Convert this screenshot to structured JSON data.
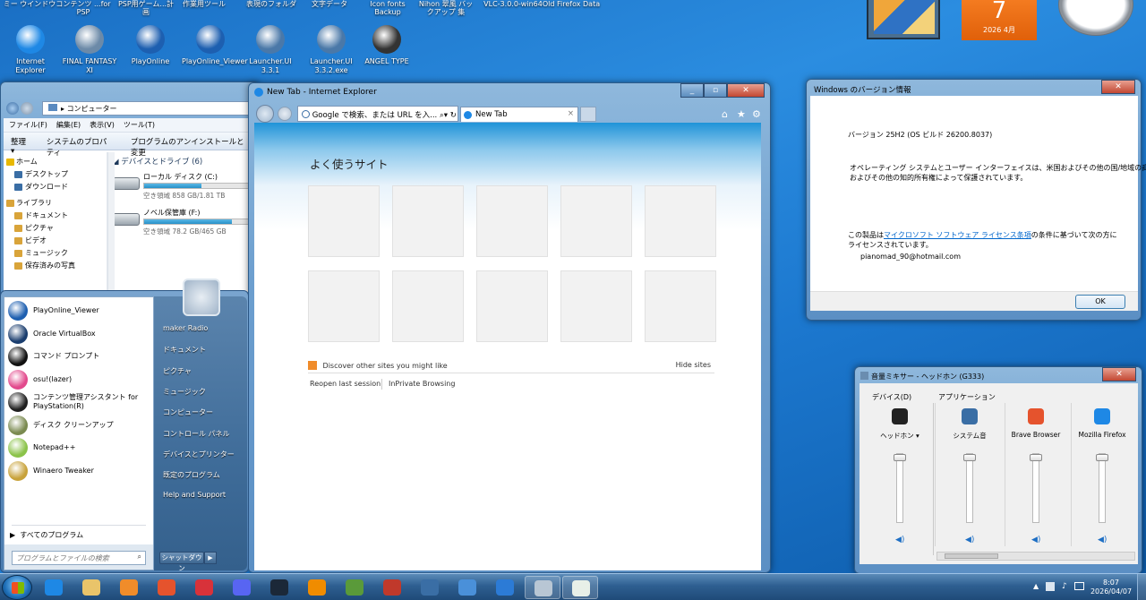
{
  "top_labels": [
    "ミー ウインドウ",
    "コンテンツ ...for PSP",
    "PSP用ゲーム...計画",
    "作業用ツール",
    "表現のフォルダ",
    "文字データ",
    "Icon fonts Backup",
    "Nihon 翠風 バックアップ 集",
    "VLC-3.0.0-win64",
    "Old Firefox Data"
  ],
  "desktop_icons": [
    {
      "label": "Internet Explorer",
      "color": "#1e88e5"
    },
    {
      "label": "FINAL FANTASY XI",
      "color": "#6c8aa8"
    },
    {
      "label": "PlayOnline",
      "color": "#1d5fb0"
    },
    {
      "label": "PlayOnline_Viewer",
      "color": "#1d5fb0"
    },
    {
      "label": "Launcher.UI 3.3.1",
      "color": "#4a78a8"
    },
    {
      "label": "Launcher.UI 3.3.2.exe",
      "color": "#4a78a8"
    },
    {
      "label": "ANGEL TYPE",
      "color": "#333333"
    }
  ],
  "gadget": {
    "day": "7",
    "month": "2026 4月"
  },
  "explorer": {
    "breadcrumb": "コンピューター",
    "menu": [
      "ファイル(F)",
      "編集(E)",
      "表示(V)",
      "ツール(T)"
    ],
    "commands": [
      "整理 ▾",
      "システムのプロパティ",
      "プログラムのアンインストールと変更"
    ],
    "nav": [
      {
        "label": "ホーム",
        "head": true,
        "color": "#e8b800"
      },
      {
        "label": "デスクトップ",
        "head": false,
        "color": "#3a6ea5"
      },
      {
        "label": "ダウンロード",
        "head": false,
        "color": "#3a6ea5"
      },
      {
        "label": "ライブラリ",
        "head": true,
        "color": "#d9a43a"
      },
      {
        "label": "ドキュメント",
        "head": false,
        "color": "#d9a43a"
      },
      {
        "label": "ピクチャ",
        "head": false,
        "color": "#d9a43a"
      },
      {
        "label": "ビデオ",
        "head": false,
        "color": "#d9a43a"
      },
      {
        "label": "ミュージック",
        "head": false,
        "color": "#d9a43a"
      },
      {
        "label": "保存済みの写真",
        "head": false,
        "color": "#d9a43a"
      }
    ],
    "group_title": "デバイスとドライブ (6)",
    "drives": [
      {
        "name": "ローカル ディスク (C:)",
        "free": "空き領域 858 GB/1.81 TB",
        "usage": 0.54
      },
      {
        "name": "ノベル保管庫 (F:)",
        "free": "空き領域 78.2 GB/465 GB",
        "usage": 0.83
      }
    ]
  },
  "ie": {
    "title": "New Tab - Internet Explorer",
    "address_placeholder": "Google で検索、または URL を入...",
    "tab_label": "New Tab",
    "heading": "よく使うサイト",
    "discover": "Discover other sites you might like",
    "hide_sites": "Hide sites",
    "reopen": "Reopen last session",
    "inprivate": "InPrivate Browsing"
  },
  "version_dialog": {
    "title": "Windows のバージョン情報",
    "version": "バージョン 25H2 (OS ビルド 26200.8037)",
    "copyright_1": "オペレーティング システムとユーザー インターフェイスは、米国およびその他の国/地域の商標",
    "copyright_2": "およびその他の知的所有権によって保護されています。",
    "license_pre": "この製品は",
    "license_link": "マイクロソフト ソフトウェア ライセンス条項",
    "license_post": "の条件に基づいて次の方に",
    "license_2": "ライセンスされています。",
    "user": "pianomad_90@hotmail.com",
    "ok": "OK"
  },
  "mixer": {
    "title": "音量ミキサー - ヘッドホン (G333)",
    "device_header": "デバイス(D)",
    "apps_header": "アプリケーション",
    "channels": [
      {
        "label": "ヘッドホン ▾",
        "color": "#222222",
        "level": 1.0
      },
      {
        "label": "システム音",
        "color": "#3a6ea5",
        "level": 1.0
      },
      {
        "label": "Brave Browser",
        "color": "#e5532d",
        "level": 1.0
      },
      {
        "label": "Mozilla Firefox",
        "color": "#1e88e5",
        "level": 1.0
      }
    ]
  },
  "start_menu": {
    "programs": [
      {
        "label": "PlayOnline_Viewer",
        "color": "#1d5fb0"
      },
      {
        "label": "Oracle VirtualBox",
        "color": "#1a3d6e"
      },
      {
        "label": "コマンド プロンプト",
        "color": "#111111"
      },
      {
        "label": "osu!(lazer)",
        "color": "#e2498c"
      },
      {
        "label": "コンテンツ管理アシスタント for PlayStation(R)",
        "color": "#202020"
      },
      {
        "label": "ディスク クリーンアップ",
        "color": "#7a8a50"
      },
      {
        "label": "Notepad++",
        "color": "#8bc34a"
      },
      {
        "label": "Winaero Tweaker",
        "color": "#c8a23a"
      }
    ],
    "all_programs": "すべてのプログラム",
    "search_placeholder": "プログラムとファイルの検索",
    "right": [
      "maker Radio",
      "ドキュメント",
      "ピクチャ",
      "ミュージック",
      "コンピューター",
      "コントロール パネル",
      "デバイスとプリンター",
      "既定のプログラム",
      "Help and Support"
    ],
    "shutdown": "シャットダウン"
  },
  "taskbar": {
    "apps": [
      {
        "name": "internet-explorer",
        "color": "#1e88e5",
        "open": false
      },
      {
        "name": "file-explorer",
        "color": "#e9c46a",
        "open": false
      },
      {
        "name": "media-player",
        "color": "#f08c2a",
        "open": false
      },
      {
        "name": "brave",
        "color": "#e5532d",
        "open": false
      },
      {
        "name": "vivaldi",
        "color": "#d8323a",
        "open": false
      },
      {
        "name": "discord",
        "color": "#5865f2",
        "open": false
      },
      {
        "name": "steam",
        "color": "#1b2838",
        "open": false
      },
      {
        "name": "vlc",
        "color": "#f08c00",
        "open": false
      },
      {
        "name": "game",
        "color": "#5a9a3a",
        "open": false
      },
      {
        "name": "tool",
        "color": "#c0392b",
        "open": false
      },
      {
        "name": "launcher",
        "color": "#3a6ea5",
        "open": false
      },
      {
        "name": "network",
        "color": "#4a90d9",
        "open": false
      },
      {
        "name": "app-blue",
        "color": "#2c7bd6",
        "open": false
      },
      {
        "name": "disc",
        "color": "#b8c6d4",
        "open": true
      },
      {
        "name": "window",
        "color": "#e8f0e8",
        "open": true
      }
    ],
    "time": "8:07",
    "date": "2026/04/07"
  }
}
